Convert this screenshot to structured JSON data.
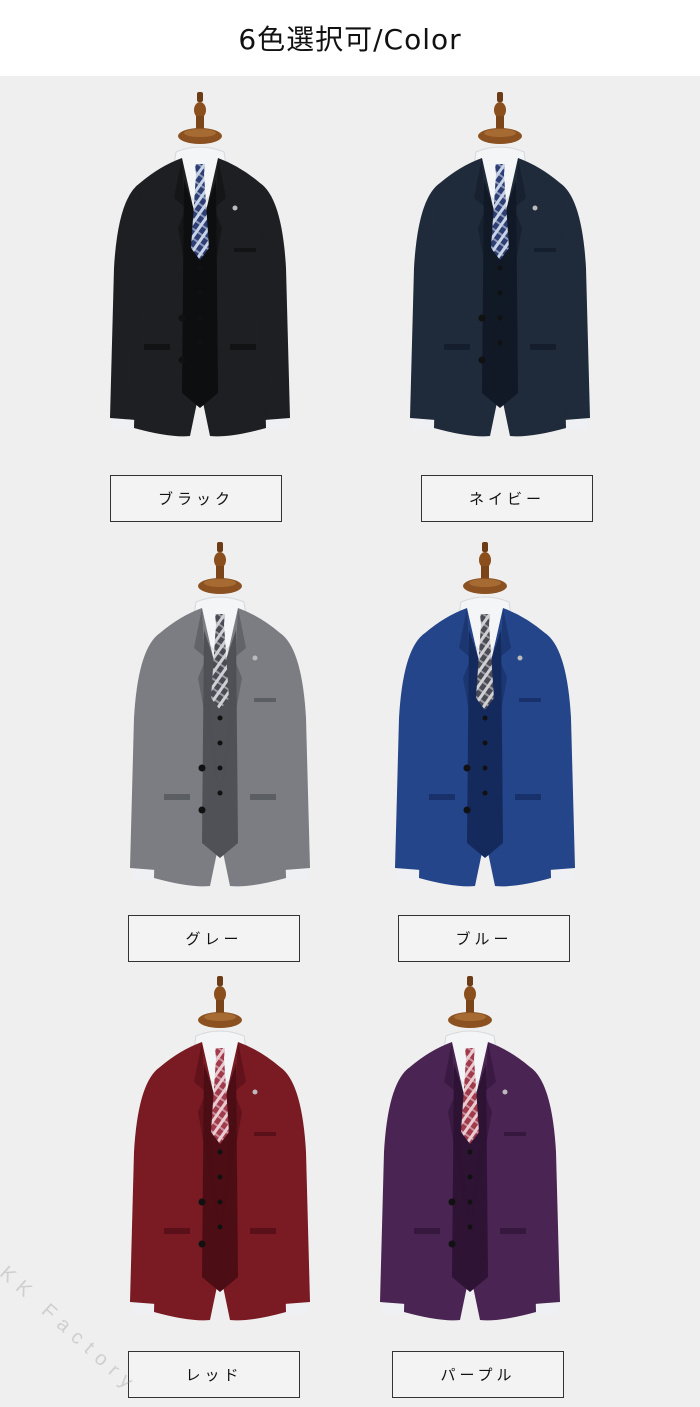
{
  "header": {
    "title": "6色選択可/Color"
  },
  "colors": [
    {
      "label": "ブラック",
      "jacket": "#1e1f22",
      "dark": "#0d0e10",
      "tie": "plaid-blue"
    },
    {
      "label": "ネイビー",
      "jacket": "#1f2a3a",
      "dark": "#111927",
      "tie": "plaid-blue"
    },
    {
      "label": "グレー",
      "jacket": "#7b7d82",
      "dark": "#4f5156",
      "tie": "plaid-grey"
    },
    {
      "label": "ブルー",
      "jacket": "#24458a",
      "dark": "#142a5c",
      "tie": "plaid-grey"
    },
    {
      "label": "レッド",
      "jacket": "#7a1a23",
      "dark": "#4d0d14",
      "tie": "plaid-red"
    },
    {
      "label": "パープル",
      "jacket": "#4a2453",
      "dark": "#2e1334",
      "tie": "plaid-red"
    }
  ],
  "watermark": "KK Factory"
}
